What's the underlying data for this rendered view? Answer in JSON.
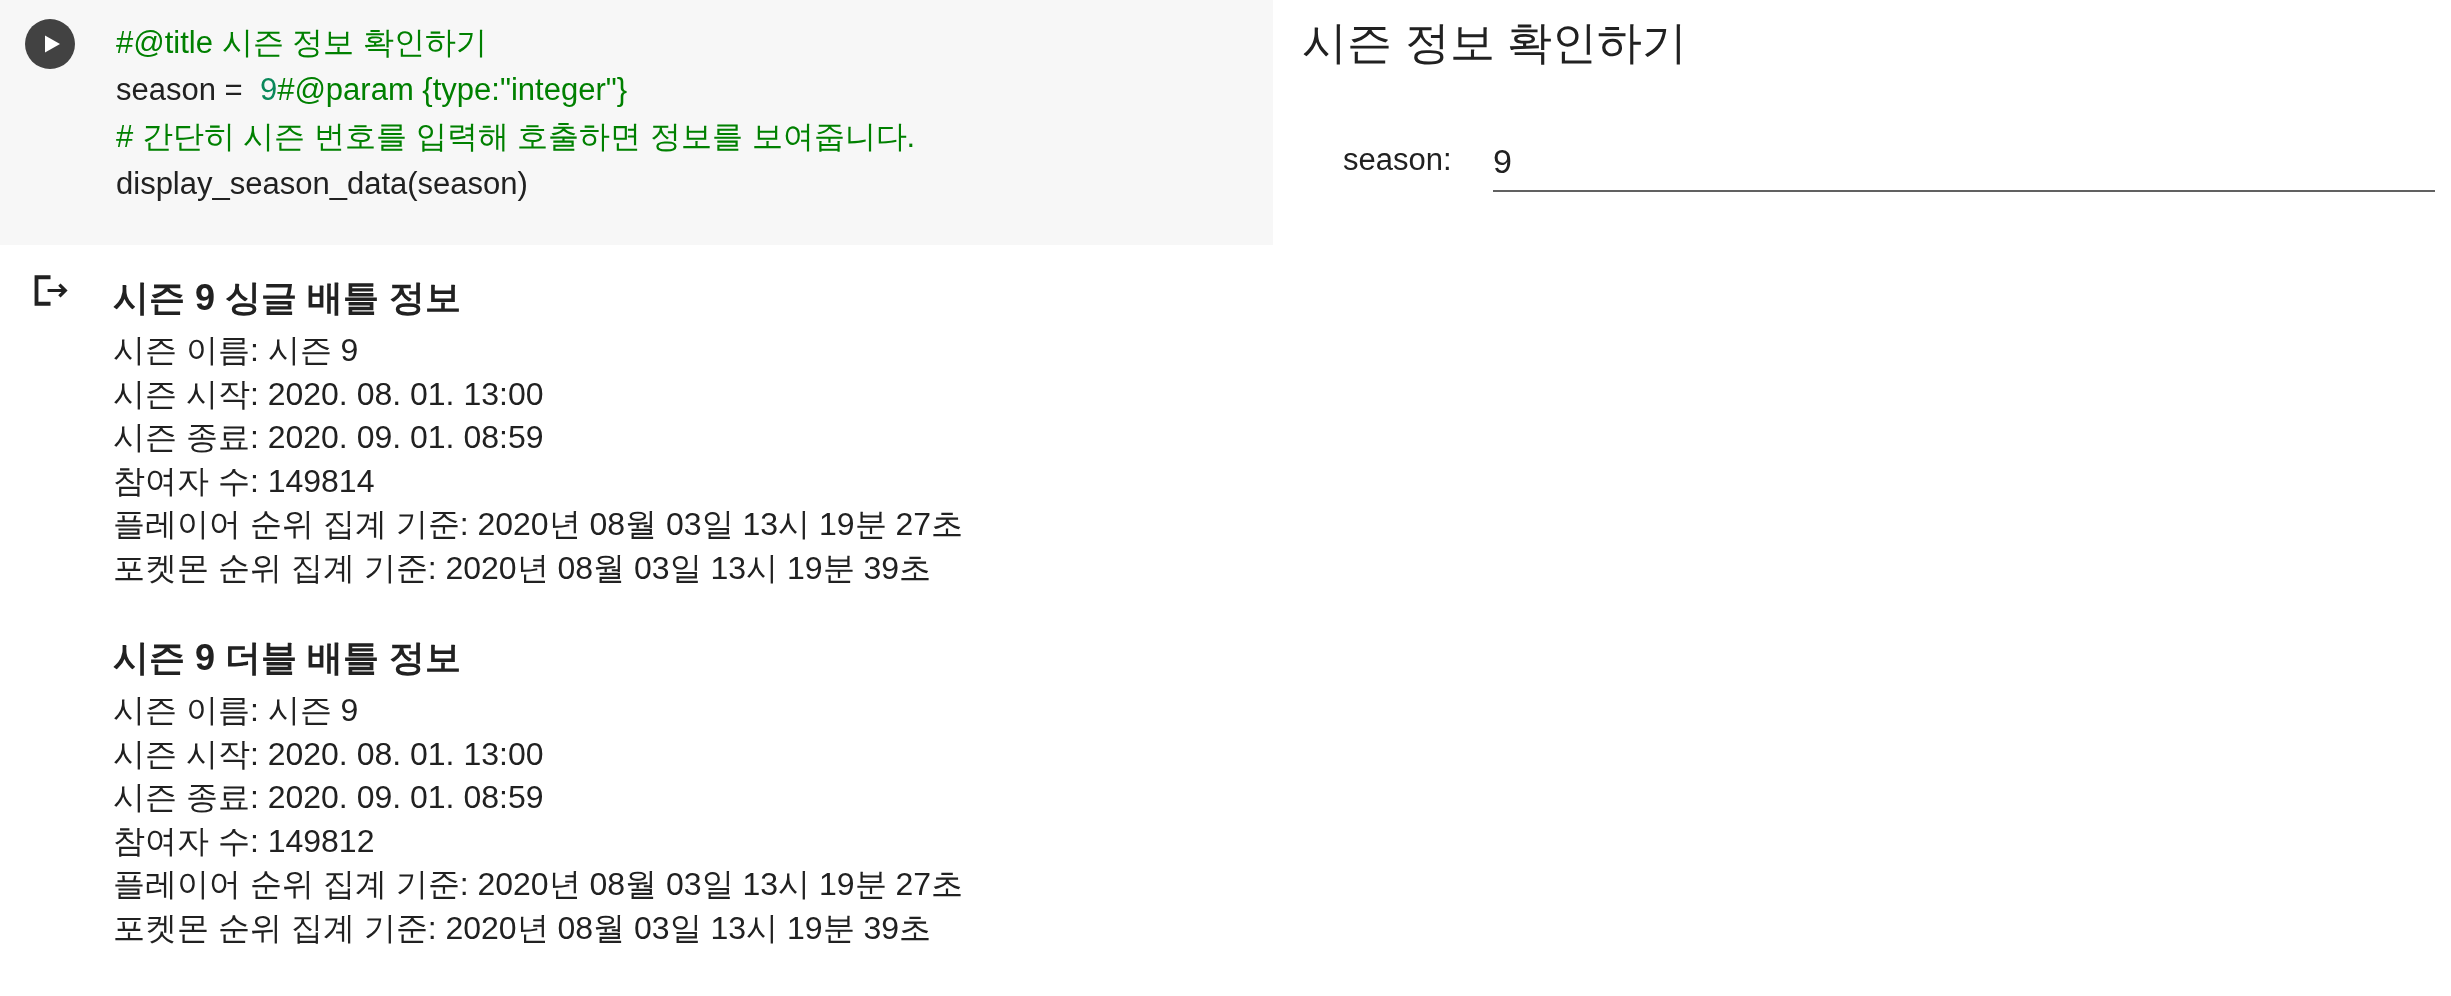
{
  "code_cell": {
    "lines": [
      {
        "segments": [
          {
            "text": "#@title 시즌 정보 확인하기",
            "kind": "comment"
          }
        ]
      },
      {
        "segments": [
          {
            "text": "season =  ",
            "kind": "plain"
          },
          {
            "text": "9",
            "kind": "number"
          },
          {
            "text": "#@param {type:\"integer\"}",
            "kind": "comment"
          }
        ]
      },
      {
        "segments": [
          {
            "text": "# 간단히 시즌 번호를 입력해 호출하면 정보를 보여줍니다.",
            "kind": "comment"
          }
        ]
      },
      {
        "segments": [
          {
            "text": "display_season_data(season)",
            "kind": "plain"
          }
        ]
      }
    ]
  },
  "form": {
    "title": "시즌 정보 확인하기",
    "fields": [
      {
        "label": "season:",
        "value": "9"
      }
    ]
  },
  "output": {
    "sections": [
      {
        "heading": "시즌 9 싱글 배틀 정보",
        "lines": [
          "시즌 이름: 시즌 9",
          "시즌 시작: 2020. 08. 01. 13:00",
          "시즌 종료: 2020. 09. 01. 08:59",
          "참여자 수: 149814",
          "플레이어 순위 집계 기준: 2020년 08월 03일 13시 19분 27초",
          "포켓몬 순위 집계 기준: 2020년 08월 03일 13시 19분 39초"
        ]
      },
      {
        "heading": "시즌 9 더블 배틀 정보",
        "lines": [
          "시즌 이름: 시즌 9",
          "시즌 시작: 2020. 08. 01. 13:00",
          "시즌 종료: 2020. 09. 01. 08:59",
          "참여자 수: 149812",
          "플레이어 순위 집계 기준: 2020년 08월 03일 13시 19분 27초",
          "포켓몬 순위 집계 기준: 2020년 08월 03일 13시 19분 39초"
        ]
      }
    ]
  }
}
